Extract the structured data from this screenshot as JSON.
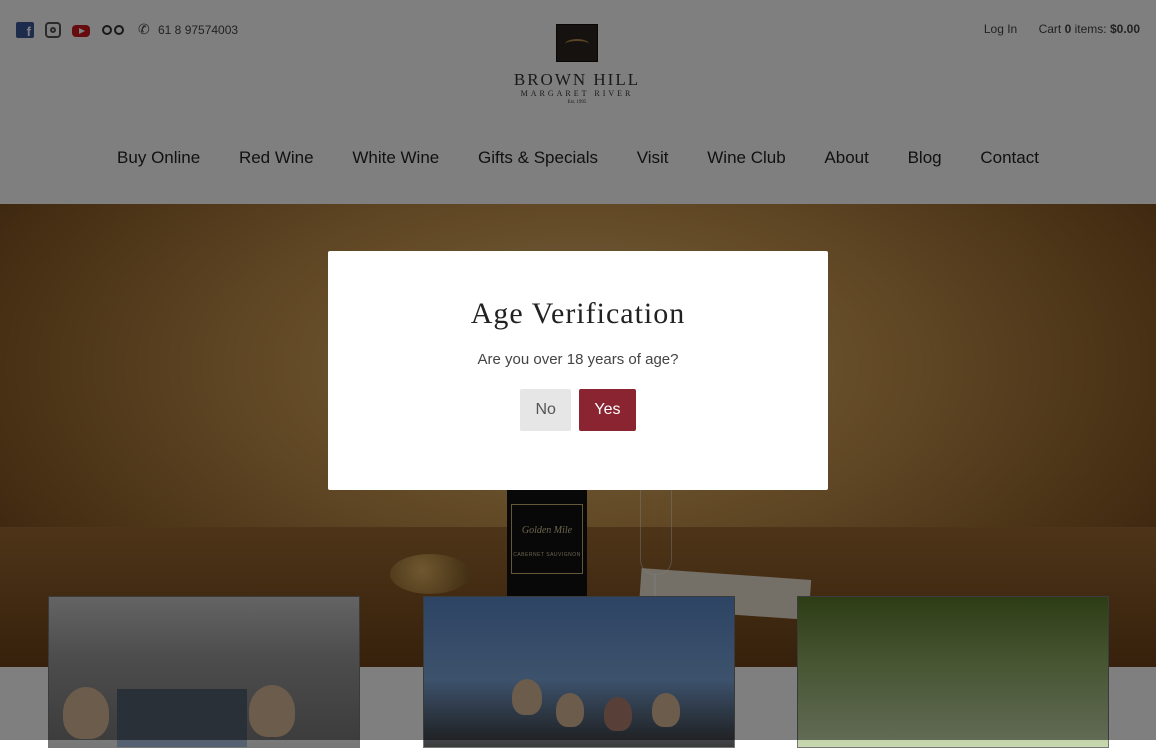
{
  "header": {
    "social_icons": [
      "facebook-icon",
      "instagram-icon",
      "youtube-icon",
      "tripadvisor-icon",
      "phone-icon"
    ],
    "phone": "61 8 97574003",
    "login": "Log In",
    "cart_prefix": "Cart",
    "cart_count": "0",
    "cart_items_label": "items:",
    "cart_total": "$0.00"
  },
  "logo": {
    "name": "BROWN HILL",
    "region": "MARGARET RIVER",
    "est": "Est. 1995"
  },
  "nav": {
    "items": [
      "Buy Online",
      "Red Wine",
      "White Wine",
      "Gifts & Specials",
      "Visit",
      "Wine Club",
      "About",
      "Blog",
      "Contact"
    ]
  },
  "hero": {
    "bottle_name": "Golden Mile",
    "bottle_variety": "CABERNET SAUVIGNON"
  },
  "modal": {
    "title": "Age Verification",
    "question": "Are you over 18 years of age?",
    "no_label": "No",
    "yes_label": "Yes"
  },
  "colors": {
    "yes_button": "#8a2430",
    "no_button": "#e6e6e6",
    "overlay": "rgba(0,0,0,0.5)"
  }
}
